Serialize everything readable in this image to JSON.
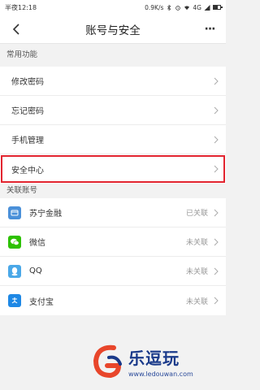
{
  "status_bar": {
    "time": "半夜12:18",
    "speed": "0.9K/s",
    "network": "4G"
  },
  "header": {
    "title": "账号与安全",
    "more_label": "···"
  },
  "common": {
    "section_title": "常用功能",
    "items": [
      {
        "label": "修改密码"
      },
      {
        "label": "忘记密码"
      },
      {
        "label": "手机管理"
      },
      {
        "label": "安全中心"
      }
    ]
  },
  "linked": {
    "section_title": "关联账号",
    "items": [
      {
        "label": "苏宁金融",
        "status": "已关联",
        "icon": "suning-finance-icon",
        "color": "#4a90d9"
      },
      {
        "label": "微信",
        "status": "未关联",
        "icon": "wechat-icon",
        "color": "#2dc100"
      },
      {
        "label": "QQ",
        "status": "未关联",
        "icon": "qq-icon",
        "color": "#4aa8e8"
      },
      {
        "label": "支付宝",
        "status": "未关联",
        "icon": "alipay-icon",
        "color": "#1e88e5"
      }
    ]
  },
  "watermark": {
    "title": "乐逗玩",
    "url": "www.ledouwan.com"
  },
  "colors": {
    "highlight": "#e2242f",
    "background": "#f2f2f2"
  }
}
